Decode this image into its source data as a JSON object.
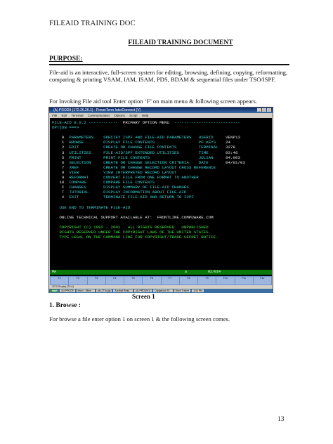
{
  "header": {
    "doc_label": "FILEAID TRAINING DOC"
  },
  "title": "FILEAID TRAINING DOCUMENT",
  "purpose_heading": "PURPOSE:",
  "purpose_text": "File-aid is an interactive, full-screen system for editing, browsing, defining, copying, reformatting, comparing & printing VSAM, IAM, ISAM, PDS, BDAM & sequential files under TSO/ISPF.",
  "invoke_text": "For Invoking File aid tool Enter option ‘F’ on main menu & following screen appears.",
  "screenshot": {
    "window_title": "(A) PROD9 (172.26.26.1) - PowerTerm InterConnect (V)",
    "menu": [
      "File",
      "Edit",
      "Terminal",
      "Communication",
      "Options",
      "Script",
      "Help"
    ],
    "terminal": {
      "line1_left": "FILE-AID 8.0.2 ------------",
      "line1_mid": "PRIMARY OPTION MENU",
      "line1_right": "---------------------------",
      "option_prompt": "OPTION ===>",
      "options": [
        {
          "code": "0",
          "name": "PARAMETERS",
          "desc": "SPECIFY ISPF AND FILE-AID PARAMETERS",
          "info_label": "USERID",
          "info_value": "VENP13"
        },
        {
          "code": "1",
          "name": "BROWSE",
          "desc": "DISPLAY FILE CONTENTS",
          "info_label": "PF KEYS",
          "info_value": "24"
        },
        {
          "code": "2",
          "name": "EDIT",
          "desc": "CREATE OR CHANGE FILE CONTENTS",
          "info_label": "TERMINAL",
          "info_value": "3278"
        },
        {
          "code": "3",
          "name": "UTILITIES",
          "desc": "FILE-AID/SPF EXTENDED UTILITIES",
          "info_label": "TIME",
          "info_value": "03:46"
        },
        {
          "code": "5",
          "name": "PRINT",
          "desc": "PRINT FILE CONTENTS",
          "info_label": "JULIAN",
          "info_value": "04.003"
        },
        {
          "code": "6",
          "name": "SELECTION",
          "desc": "CREATE OR CHANGE SELECTION CRITERIA",
          "info_label": "DATE",
          "info_value": "04/01/03"
        },
        {
          "code": "7",
          "name": "XREF",
          "desc": "CREATE OR CHANGE RECORD LAYOUT CROSS REFERENCE",
          "info_label": "",
          "info_value": ""
        },
        {
          "code": "8",
          "name": "VIEW",
          "desc": "VIEW INTERPRETED RECORD LAYOUT",
          "info_label": "",
          "info_value": ""
        },
        {
          "code": "9",
          "name": "REFORMAT",
          "desc": "CONVERT FILE FROM ONE FORMAT TO ANOTHER",
          "info_label": "",
          "info_value": ""
        },
        {
          "code": "10",
          "name": "COMPARE",
          "desc": "COMPARE FILE CONTENTS",
          "info_label": "",
          "info_value": ""
        },
        {
          "code": "C",
          "name": "CHANGES",
          "desc": "DISPLAY SUMMARY OF FILE-AID CHANGES",
          "info_label": "",
          "info_value": ""
        },
        {
          "code": "T",
          "name": "TUTORIAL",
          "desc": "DISPLAY INFORMATION ABOUT FILE-AID",
          "info_label": "",
          "info_value": ""
        },
        {
          "code": "X",
          "name": "EXIT",
          "desc": "TERMINATE FILE-AID AND RETURN TO ISPF",
          "info_label": "",
          "info_value": ""
        }
      ],
      "end_line": "USE END TO TERMINATE FILE-AID",
      "support_line": "ONLINE TECHNICAL SUPPORT AVAILABLE AT:  FRONTLINE.COMPUWARE.COM",
      "copyright1": "COPYRIGHT (C) 1982 - 2001   ALL RIGHTS RESERVED   UNPUBLISHED",
      "copyright2": "RIGHTS RESERVED UNDER THE COPYRIGHT LAWS OF THE UNITED STATES.",
      "copyright3": "TYPE LEGAL ON THE COMMAND LINE FOR COPYRIGHT/TRADE SECRET NOTICE."
    },
    "statusbar": {
      "left": "MA",
      "right": "a          02/014"
    },
    "pfkeys": [
      "F1",
      "F2",
      "F3",
      "F4",
      "F5",
      "F6",
      "F7",
      "F8",
      "F9",
      "F10",
      "F11",
      "F12"
    ],
    "oia": "3270 Display  [T3:A]",
    "taskbar": [
      "start",
      "(A) PROD9",
      "Inbox - Micro...",
      "pbi-27.ts.jpg",
      "Acrobat Read...",
      "(A) PROD9(1)",
      "Dangerous Si...",
      "Word Trainer",
      "3:00 PM"
    ]
  },
  "caption": "Screen 1",
  "section_heading": "1. Browse :",
  "browse_text": "For browse a file enter option 1 on screen 1 & the following screen comes.",
  "page_number": "13",
  "colors": {
    "terminal_bg": "#000000",
    "terminal_cyan": "#3fd8d8",
    "terminal_green": "#49e04a",
    "terminal_white": "#e8e8e8",
    "title_blue": "#0a246a"
  }
}
